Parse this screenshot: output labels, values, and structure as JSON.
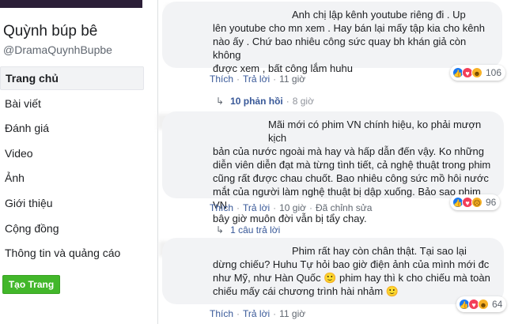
{
  "page": {
    "name": "Quỳnh búp bê",
    "handle": "@DramaQuynhBupbe"
  },
  "nav": {
    "items": [
      {
        "label": "Trang chủ"
      },
      {
        "label": "Bài viết"
      },
      {
        "label": "Đánh giá"
      },
      {
        "label": "Video"
      },
      {
        "label": "Ảnh"
      },
      {
        "label": "Giới thiệu"
      },
      {
        "label": "Cộng đồng"
      },
      {
        "label": "Thông tin và quảng cáo"
      }
    ],
    "create_button": "Tạo Trang"
  },
  "comments": [
    {
      "lines": [
        "Anh chị lập kênh youtube riêng đi . Up",
        "lên youtube cho mn xem . Hay bán lại mấy tập kia cho kênh",
        "nào ấy . Chứ bao nhiêu công sức quay bh khán giả còn không",
        "được xem , bất công lắm huhu"
      ],
      "like": "Thích",
      "reply": "Trả lời",
      "time": "11 giờ",
      "reaction_icons": [
        "like-icon",
        "love-icon",
        "haha-icon"
      ],
      "reaction_count": "106",
      "replies_count": "10 phản hồi",
      "replies_time": "8 giờ"
    },
    {
      "lines": [
        "Mãi mới có phim VN chính hiệu, ko phải mượn kịch",
        "bản của nước ngoài mà hay và hấp dẫn đến vậy. Ko những",
        "diễn viên diễn đạt mà từng tình tiết, cả nghệ thuật trong phim",
        "cũng rất được chau chuốt. Bao nhiêu công sức mồ hôi nước",
        "mắt của người làm nghệ thuật bị dập xuống. Bảo sao phim VN",
        "bây giờ muôn đời vẫn bị tẩy chay."
      ],
      "like": "Thích",
      "reply": "Trả lời",
      "time": "10 giờ",
      "edited": "Đã chỉnh sửa",
      "reaction_icons": [
        "like-icon",
        "love-icon",
        "sad-icon"
      ],
      "reaction_count": "96",
      "replies_count": "1 câu trả lời"
    },
    {
      "lines": [
        "Phim rất hay còn chân thật. Tại sao lại",
        "dừng chiếu? Huhu Tự hỏi bao giờ điện ảnh của mình mới đc",
        "như Mỹ, như Hàn Quốc 🙂 phim hay thì k cho chiếu mà toàn",
        "chiếu mấy cái chương trình hài nhảm 🙂"
      ],
      "like": "Thích",
      "reply": "Trả lời",
      "time": "11 giờ",
      "reaction_icons": [
        "like-icon",
        "love-icon",
        "haha-icon"
      ],
      "reaction_count": "64"
    }
  ]
}
